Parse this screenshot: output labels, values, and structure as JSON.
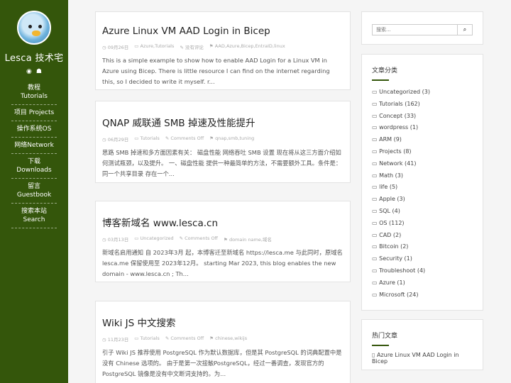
{
  "site": {
    "title": "Lesca 技术宅"
  },
  "nav": [
    {
      "zh": "教程",
      "en": "Tutorials"
    },
    {
      "zh": "项目",
      "en": "Projects"
    },
    {
      "zh": "操作系统",
      "en": "OS"
    },
    {
      "zh": "网络",
      "en": "Network"
    },
    {
      "zh": "下载",
      "en": "Downloads"
    },
    {
      "zh": "留言",
      "en": "Guestbook"
    },
    {
      "zh": "搜索本站",
      "en": "Search"
    }
  ],
  "posts": [
    {
      "title": "Azure Linux VM AAD Login in Bicep",
      "date": "09月26日",
      "category": "Azure,Tutorials",
      "comments": "没有评论",
      "tags": "AAD,Azure,Bicep,EntraID,linux",
      "excerpt": "This is a simple example to show how to enable AAD Login for a Linux VM in Azure using Bicep. There is little resource I can find on the internet regarding this, so I decided to write it myself. r..."
    },
    {
      "title": "QNAP 威联通 SMB 掉速及性能提升",
      "date": "06月29日",
      "category": "Tutorials",
      "comments": "Comments Off",
      "tags": "qnap,smb,tuning",
      "excerpt": "思路 SMB 掉速和多方面因素有关： 磁盘性能 网络吞吐 SMB 设置 现在将从这三方面介绍如何测试瓶颈，以及提升。 一、磁盘性能 提供一种最简单的方法，不需要额外工具。条件是： 同一个共享目录 存在一个..."
    },
    {
      "title": "博客新域名 www.lesca.cn",
      "date": "03月13日",
      "category": "Uncategorized",
      "comments": "Comments Off",
      "tags": "domain name,域名",
      "excerpt": "新域名启用通知 自 2023年3月 起，本博客迁至新域名 https://lesca.me 与此同时，原域名 lesca.me 保留使用至 2023年12月。 starting Mar 2023, this blog enables the new domain - www.lesca.cn ; Th..."
    },
    {
      "title": "Wiki JS 中文搜索",
      "date": "11月23日",
      "category": "Tutorials",
      "comments": "Comments Off",
      "tags": "chinese,wikijs",
      "excerpt": "引子 Wiki JS 推荐使用 PostgreSQL 作为默认数据库，但是其 PostgreSQL 的词典配置中是没有 Chinese 选项的。 由于是第一次接触PostgreSQL，经过一番调查，发现官方的 PostgreSQL 镜像是没有中文断词支持的。为..."
    }
  ],
  "search": {
    "placeholder": "搜索...",
    "button": "search-icon"
  },
  "categories": {
    "title": "文章分类",
    "items": [
      "Uncategorized (3)",
      "Tutorials (162)",
      "Concept (33)",
      "wordpress (1)",
      "ARM (9)",
      "Projects (8)",
      "Network (41)",
      "Math (3)",
      "life (5)",
      "Apple (3)",
      "SQL (4)",
      "OS (112)",
      "CAD (2)",
      "Bitcoin (2)",
      "Security (1)",
      "Troubleshoot (4)",
      "Azure (1)",
      "Microsoft (24)"
    ]
  },
  "hot": {
    "title": "热门文章",
    "items": [
      "Azure Linux VM AAD Login in Bicep"
    ]
  },
  "colors": {
    "sidebar": "#34560b",
    "accent": "#34560b"
  }
}
